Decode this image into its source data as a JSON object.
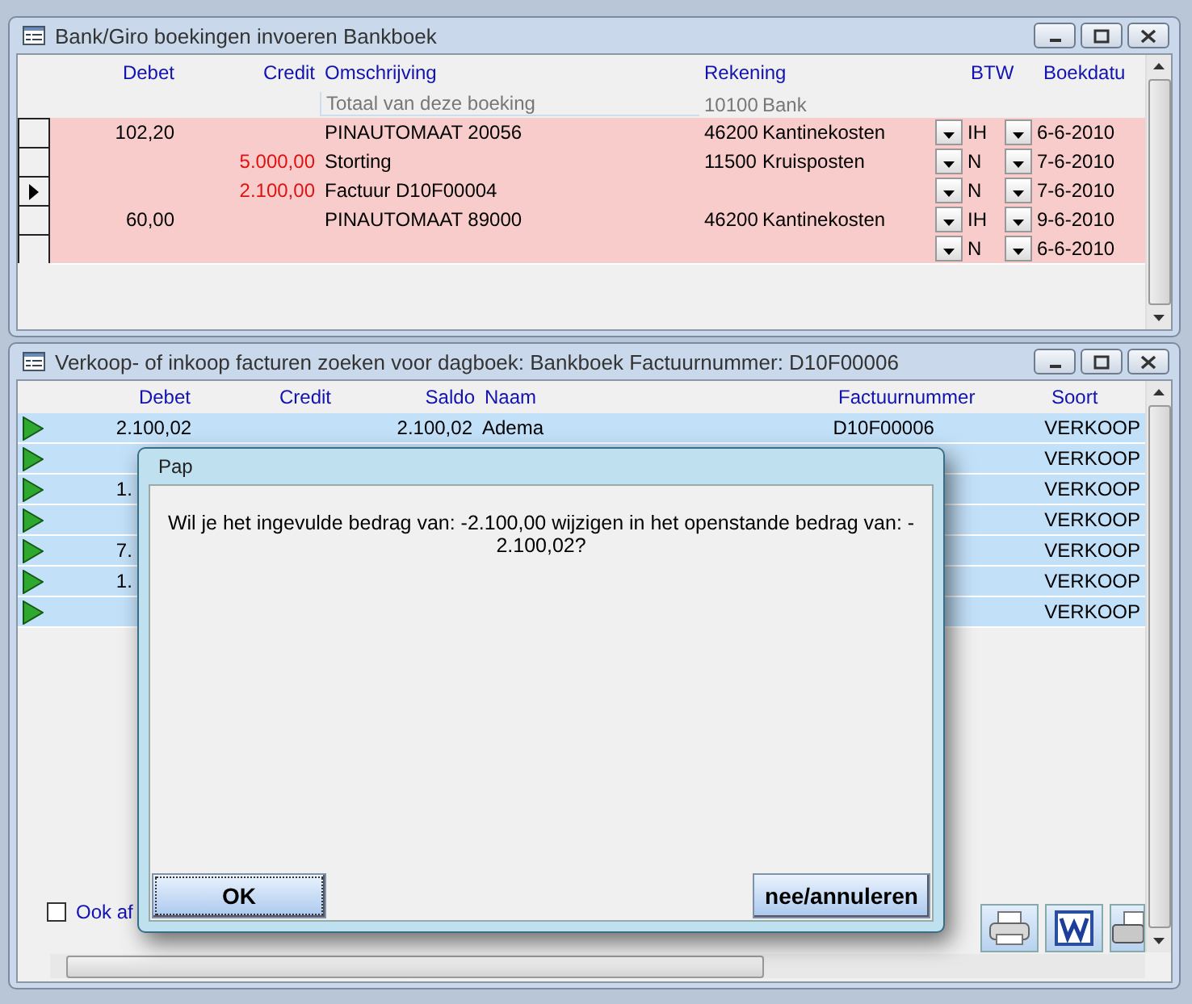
{
  "bank_window": {
    "title": "Bank/Giro boekingen invoeren Bankboek",
    "columns": [
      "Debet",
      "Credit",
      "Omschrijving",
      "Rekening",
      "BTW",
      "Boekdatu"
    ],
    "total_row": {
      "description": "Totaal van deze boeking",
      "account": "10100",
      "account_name": "Bank"
    },
    "rows": [
      {
        "selected": false,
        "debet": "102,20",
        "description": "PINAUTOMAAT 20056",
        "account": "46200",
        "account_name": "Kantinekosten",
        "btw": "IH",
        "date": "6-6-2010"
      },
      {
        "selected": false,
        "credit": "5.000,00",
        "description": "Storting",
        "account": "11500",
        "account_name": "Kruisposten",
        "btw": "N",
        "date": "7-6-2010"
      },
      {
        "selected": true,
        "credit": "2.100,00",
        "description": "Factuur D10F00004",
        "btw": "N",
        "date": "7-6-2010"
      },
      {
        "selected": false,
        "debet": "60,00",
        "description": "PINAUTOMAAT 89000",
        "account": "46200",
        "account_name": "Kantinekosten",
        "btw": "IH",
        "date": "9-6-2010"
      },
      {
        "selected": false,
        "btw": "N",
        "date": "6-6-2010"
      }
    ]
  },
  "invoice_window": {
    "title": "Verkoop- of inkoop facturen zoeken voor dagboek: Bankboek Factuurnummer: D10F00006",
    "columns": [
      "Debet",
      "Credit",
      "Saldo",
      "Naam",
      "Factuurnummer",
      "Soort"
    ],
    "rows": [
      {
        "debet": "2.100,02",
        "saldo": "2.100,02",
        "name": "Adema",
        "invoice": "D10F00006",
        "type": "VERKOOP"
      },
      {
        "type": "VERKOOP"
      },
      {
        "debet": "1.",
        "type": "VERKOOP"
      },
      {
        "type": "VERKOOP"
      },
      {
        "debet": "7.",
        "type": "VERKOOP"
      },
      {
        "debet": "1.",
        "type": "VERKOOP"
      },
      {
        "type": "VERKOOP"
      }
    ],
    "checkbox": {
      "label": "Ook af",
      "checked": false
    }
  },
  "dialog": {
    "title": "Pap",
    "message": "Wil je het ingevulde bedrag van: -2.100,00 wijzigen in het openstande bedrag van: -\n2.100,02?",
    "buttons": [
      {
        "label": "OK",
        "focused": true
      },
      {
        "label": "nee/annuleren",
        "focused": false
      }
    ]
  }
}
